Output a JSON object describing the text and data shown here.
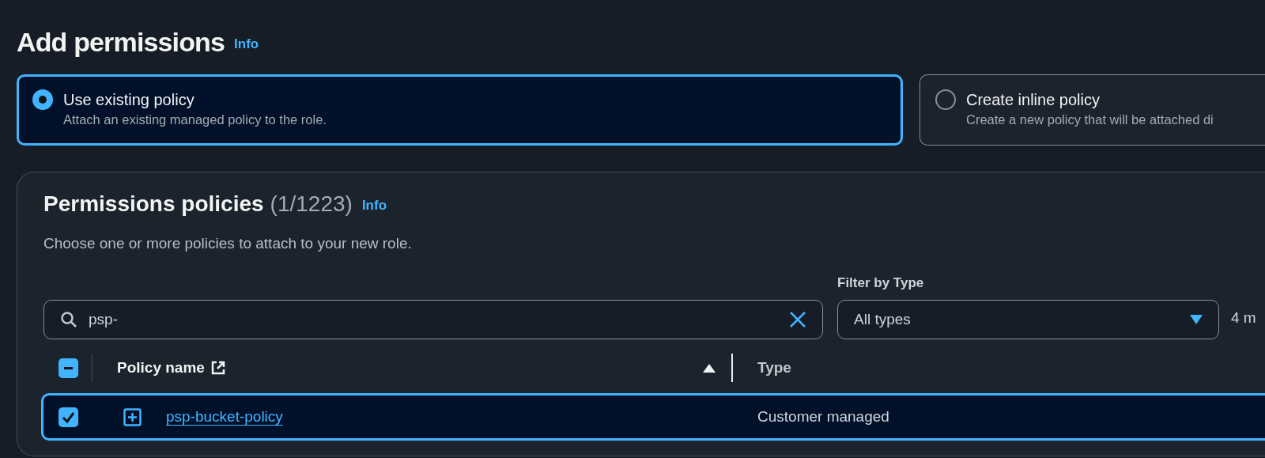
{
  "page_title": "Add permissions",
  "page_info_link": "Info",
  "options": [
    {
      "title": "Use existing policy",
      "description": "Attach an existing managed policy to the role.",
      "selected": true
    },
    {
      "title": "Create inline policy",
      "description": "Create a new policy that will be attached di",
      "selected": false
    }
  ],
  "policies": {
    "title": "Permissions policies",
    "count": "(1/1223)",
    "info_link": "Info",
    "description": "Choose one or more policies to attach to your new role.",
    "search": {
      "value": "psp-"
    },
    "filter": {
      "label": "Filter by Type",
      "value": "All types"
    },
    "match_count": "4 m",
    "table": {
      "select_all_indeterminate": true,
      "columns": [
        {
          "label": "Policy name",
          "sorted_ascending": true
        },
        {
          "label": "Type",
          "sorted_ascending": false
        }
      ],
      "rows": [
        {
          "name": "psp-bucket-policy",
          "type": "Customer managed",
          "selected": true
        }
      ]
    }
  }
}
